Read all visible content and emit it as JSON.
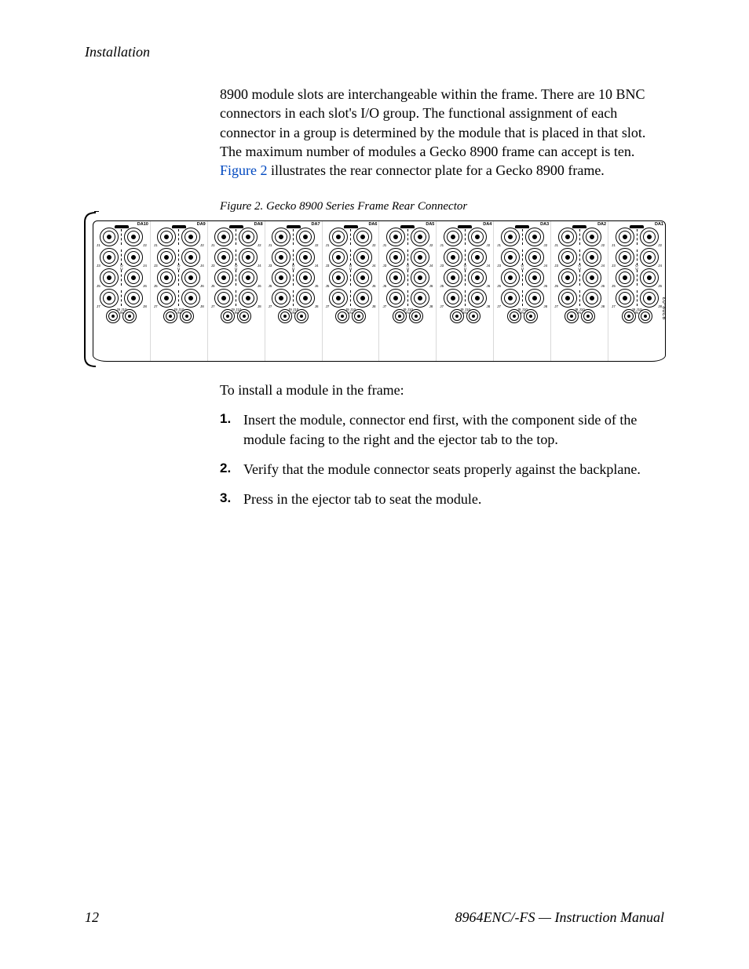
{
  "running_head": "Installation",
  "paragraph": {
    "pre": "8900 module slots are interchangeable within the frame. There are 10 BNC connectors in each slot's I/O group. The functional assignment of each connector in a group is determined by the module that is placed in that slot. The maximum number of modules a Gecko 8900 frame can accept is ten. ",
    "xref": "Figure 2",
    "post": " illustrates the rear connector plate for a Gecko 8900 frame."
  },
  "figure": {
    "caption": "Figure 2.  Gecko 8900 Series Frame Rear Connector",
    "part_number": "8208-03",
    "slots": [
      "DA1",
      "DA2",
      "DA3",
      "DA4",
      "DA5",
      "DA6",
      "DA7",
      "DA8",
      "DA9",
      "DA10"
    ],
    "row_labels": {
      "r1": {
        "left": "J1",
        "right": "J2"
      },
      "r2": {
        "left": "J3",
        "center_top": "O",
        "center_bottom": "U",
        "right": "J4"
      },
      "r3": {
        "left": "J5",
        "right": "J6"
      },
      "r4": {
        "left": "J7",
        "center": "J9  J10",
        "right": "J8"
      },
      "in": {
        "center": "IN"
      }
    }
  },
  "instructions": {
    "intro": "To install a module in the frame:",
    "steps": [
      "Insert the module, connector end first, with the component side of the module facing to the right and the ejector tab to the top.",
      "Verify that the module connector seats properly against the backplane.",
      "Press in the ejector tab to seat the module."
    ]
  },
  "footer": {
    "page": "12",
    "doc": "8964ENC/-FS — Instruction Manual"
  }
}
